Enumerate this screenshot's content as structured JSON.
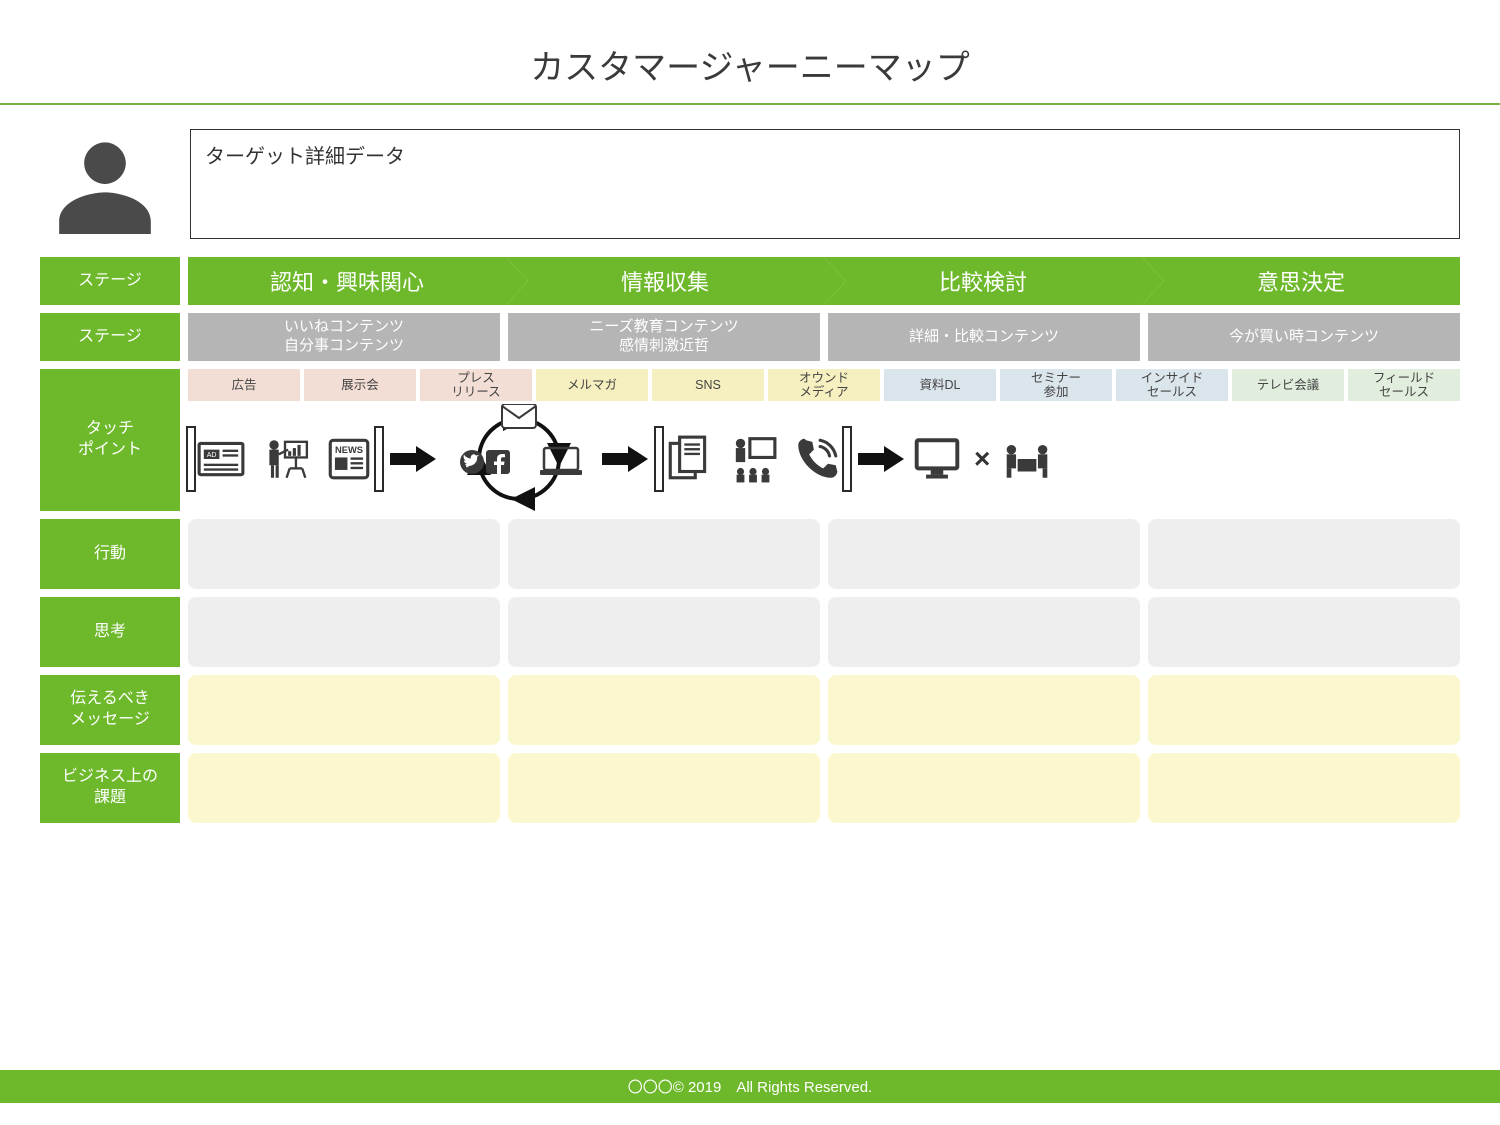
{
  "title": "カスタマージャーニーマップ",
  "target_box_label": "ターゲット詳細データ",
  "row_labels": {
    "stage": "ステージ",
    "content_stage": "ステージ",
    "touchpoint": "タッチ\nポイント",
    "behavior": "行動",
    "thought": "思考",
    "message": "伝えるべき\nメッセージ",
    "issue": "ビジネス上の\n課題"
  },
  "stages": [
    "認知・興味関心",
    "情報収集",
    "比較検討",
    "意思決定"
  ],
  "content_stages": [
    {
      "l1": "いいねコンテンツ",
      "l2": "自分事コンテンツ"
    },
    {
      "l1": "ニーズ教育コンテンツ",
      "l2": "感情刺激近哲"
    },
    {
      "l1": "詳細・比較コンテンツ",
      "l2": ""
    },
    {
      "l1": "今が買い時コンテンツ",
      "l2": ""
    }
  ],
  "touchpoints": [
    {
      "label": "広告",
      "color": "c-pink"
    },
    {
      "label": "展示会",
      "color": "c-pink"
    },
    {
      "label": "プレス\nリリース",
      "color": "c-pink"
    },
    {
      "label": "メルマガ",
      "color": "c-yellow"
    },
    {
      "label": "SNS",
      "color": "c-yellow"
    },
    {
      "label": "オウンド\nメディア",
      "color": "c-yellow"
    },
    {
      "label": "資料DL",
      "color": "c-blue"
    },
    {
      "label": "セミナー\n参加",
      "color": "c-blue"
    },
    {
      "label": "インサイド\nセールス",
      "color": "c-blue"
    },
    {
      "label": "テレビ会議",
      "color": "c-green"
    },
    {
      "label": "フィールド\nセールス",
      "color": "c-green"
    }
  ],
  "footer": "〇〇〇© 2019　All Rights Reserved."
}
